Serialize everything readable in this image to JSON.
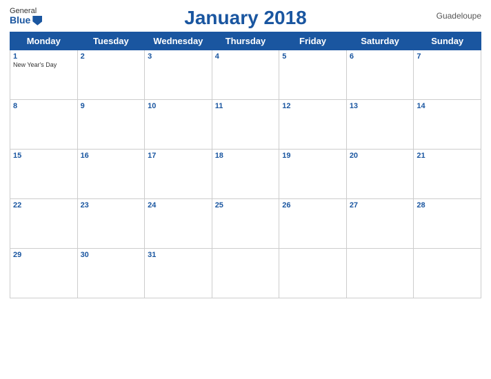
{
  "header": {
    "logo_general": "General",
    "logo_blue": "Blue",
    "title": "January 2018",
    "country": "Guadeloupe"
  },
  "weekdays": [
    "Monday",
    "Tuesday",
    "Wednesday",
    "Thursday",
    "Friday",
    "Saturday",
    "Sunday"
  ],
  "weeks": [
    [
      {
        "day": "1",
        "holiday": "New Year's Day"
      },
      {
        "day": "2",
        "holiday": ""
      },
      {
        "day": "3",
        "holiday": ""
      },
      {
        "day": "4",
        "holiday": ""
      },
      {
        "day": "5",
        "holiday": ""
      },
      {
        "day": "6",
        "holiday": ""
      },
      {
        "day": "7",
        "holiday": ""
      }
    ],
    [
      {
        "day": "8",
        "holiday": ""
      },
      {
        "day": "9",
        "holiday": ""
      },
      {
        "day": "10",
        "holiday": ""
      },
      {
        "day": "11",
        "holiday": ""
      },
      {
        "day": "12",
        "holiday": ""
      },
      {
        "day": "13",
        "holiday": ""
      },
      {
        "day": "14",
        "holiday": ""
      }
    ],
    [
      {
        "day": "15",
        "holiday": ""
      },
      {
        "day": "16",
        "holiday": ""
      },
      {
        "day": "17",
        "holiday": ""
      },
      {
        "day": "18",
        "holiday": ""
      },
      {
        "day": "19",
        "holiday": ""
      },
      {
        "day": "20",
        "holiday": ""
      },
      {
        "day": "21",
        "holiday": ""
      }
    ],
    [
      {
        "day": "22",
        "holiday": ""
      },
      {
        "day": "23",
        "holiday": ""
      },
      {
        "day": "24",
        "holiday": ""
      },
      {
        "day": "25",
        "holiday": ""
      },
      {
        "day": "26",
        "holiday": ""
      },
      {
        "day": "27",
        "holiday": ""
      },
      {
        "day": "28",
        "holiday": ""
      }
    ],
    [
      {
        "day": "29",
        "holiday": ""
      },
      {
        "day": "30",
        "holiday": ""
      },
      {
        "day": "31",
        "holiday": ""
      },
      {
        "day": "",
        "holiday": ""
      },
      {
        "day": "",
        "holiday": ""
      },
      {
        "day": "",
        "holiday": ""
      },
      {
        "day": "",
        "holiday": ""
      }
    ]
  ],
  "colors": {
    "header_bg": "#1a56a0",
    "header_text": "#ffffff",
    "day_number": "#1a56a0",
    "title": "#1a56a0"
  }
}
